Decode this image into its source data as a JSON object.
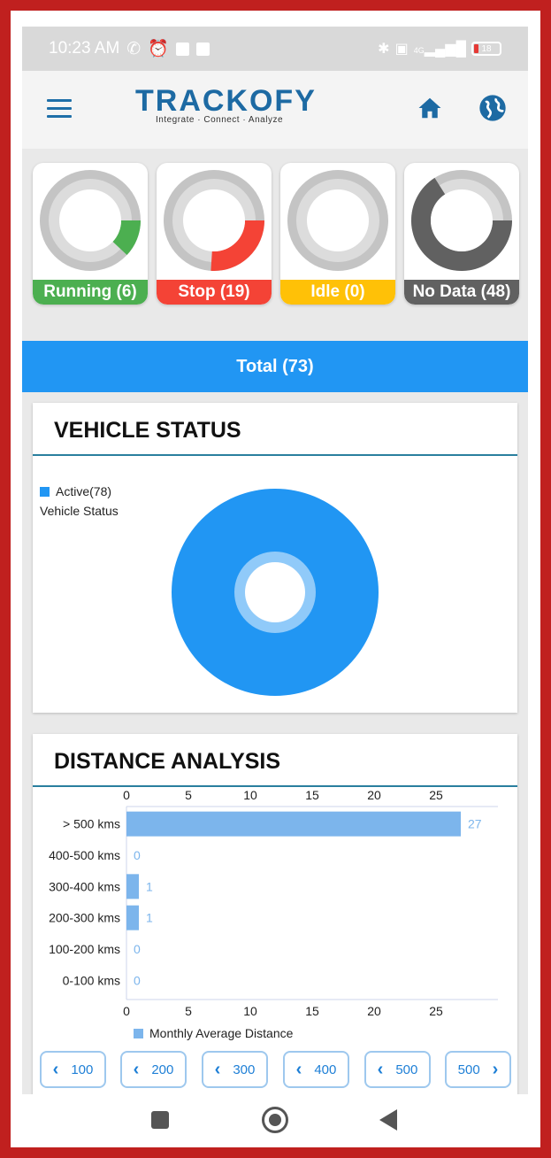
{
  "statusbar": {
    "time": "10:23 AM",
    "icons_left": [
      "wifi-calling-icon",
      "alarm-icon",
      "notification-square-icon",
      "notification-square-icon"
    ],
    "icons_right": [
      "bluetooth-icon",
      "volte-icon",
      "signal-4g-icon",
      "battery-icon"
    ],
    "network": "4G",
    "battery": "18"
  },
  "appbar": {
    "logo_text": "TRACKOFY",
    "tagline": "Integrate  ·  Connect  ·  Analyze",
    "icons": [
      "menu-icon",
      "home-icon",
      "globe-icon"
    ]
  },
  "status_cards": [
    {
      "label": "Running (6)",
      "color": "#4caf50",
      "fraction": 0.12,
      "arc_color": "#4caf50"
    },
    {
      "label": "Stop (19)",
      "color": "#f44336",
      "fraction": 0.26,
      "arc_color": "#f44336"
    },
    {
      "label": "Idle (0)",
      "color": "#ffc107",
      "fraction": 0.0,
      "arc_color": "#ffc107"
    },
    {
      "label": "No Data (48)",
      "color": "#616161",
      "fraction": 0.66,
      "arc_color": "#616161"
    }
  ],
  "total": {
    "label": "Total (73)"
  },
  "vehicle_status": {
    "title": "VEHICLE STATUS",
    "legend_item": "Active(78)",
    "legend_caption": "Vehicle Status",
    "color": "#2196f3"
  },
  "distance_analysis": {
    "title": "DISTANCE ANALYSIS",
    "range_buttons": [
      {
        "dir": "prev",
        "label": "100"
      },
      {
        "dir": "prev",
        "label": "200"
      },
      {
        "dir": "prev",
        "label": "300"
      },
      {
        "dir": "prev",
        "label": "400"
      },
      {
        "dir": "prev",
        "label": "500"
      },
      {
        "dir": "next",
        "label": "500"
      }
    ]
  },
  "chart_data": {
    "type": "bar",
    "orientation": "horizontal",
    "categories": [
      "> 500 kms",
      "400-500 kms",
      "300-400 kms",
      "200-300 kms",
      "100-200 kms",
      "0-100 kms"
    ],
    "series": [
      {
        "name": "Monthly Average Distance",
        "values": [
          27,
          0,
          1,
          1,
          0,
          0
        ]
      }
    ],
    "xlim": [
      0,
      30
    ],
    "ticks": [
      0,
      5,
      10,
      15,
      20,
      25
    ],
    "bar_color": "#7cb5ec",
    "label_color": "#7cb5ec",
    "legend_position": "bottom"
  }
}
